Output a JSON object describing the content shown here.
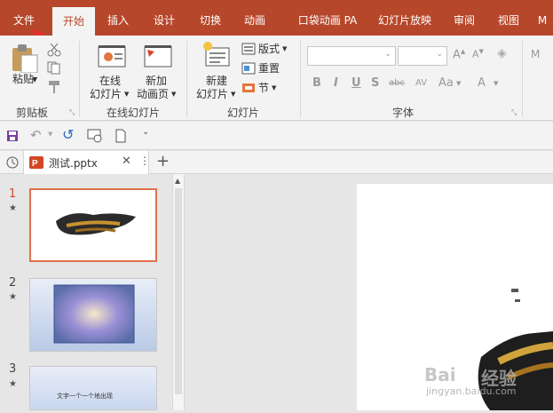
{
  "tabs": [
    "文件",
    "开始",
    "插入",
    "设计",
    "切换",
    "动画",
    "口袋动画 PA",
    "幻灯片放映",
    "审阅",
    "视图",
    "M"
  ],
  "ribbon": {
    "paste_label": "粘贴",
    "clipboard_label": "剪贴板",
    "online_slide_label1": "在线",
    "online_slide_label2": "幻灯片",
    "new_anim_label1": "新加",
    "new_anim_label2": "动画页",
    "online_group_label": "在线幻灯片",
    "new_slide_label1": "新建",
    "new_slide_label2": "幻灯片",
    "layout_label": "版式",
    "reset_label": "重置",
    "section_label": "节",
    "slides_group_label": "幻灯片",
    "font_group_label": "字体",
    "font_buttons": [
      "B",
      "I",
      "U",
      "S",
      "abc",
      "AV",
      "Aa",
      "A"
    ]
  },
  "doc_tab": {
    "title": "测试.pptx"
  },
  "thumbnails": [
    {
      "num": "1",
      "text": ""
    },
    {
      "num": "2",
      "text": ""
    },
    {
      "num": "3",
      "text": "文字一个一个地出现"
    }
  ],
  "watermark": {
    "brand": "Bai",
    "suffix": "经验",
    "url": "jingyan.baidu.com"
  },
  "colors": {
    "accent": "#b7472a",
    "selected_border": "#e0704f"
  }
}
